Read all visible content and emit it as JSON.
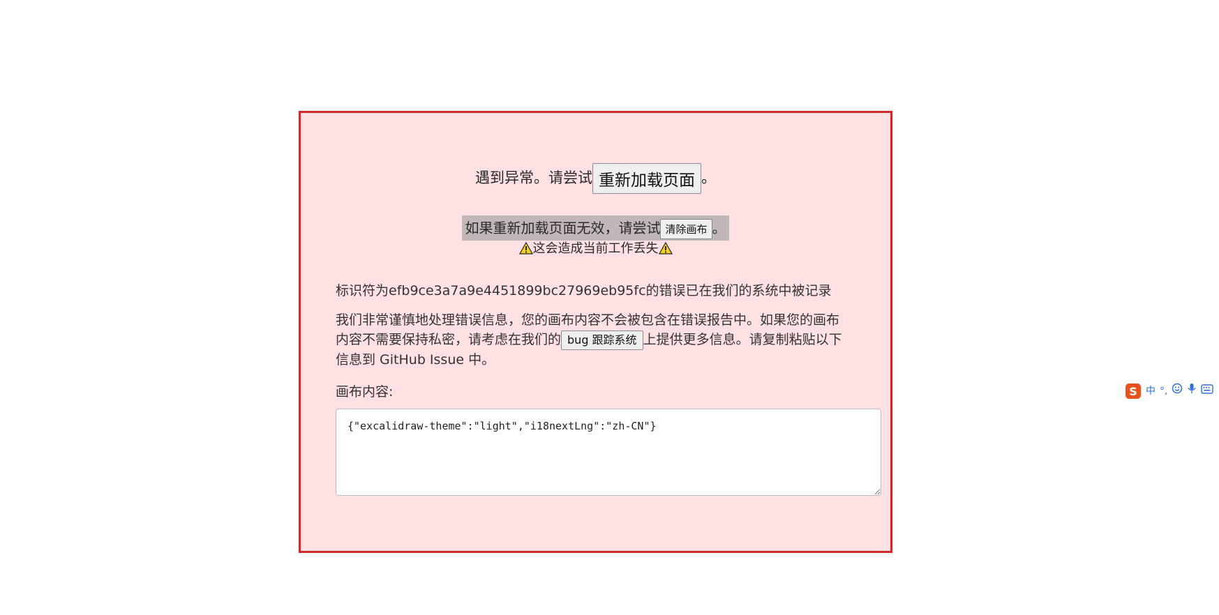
{
  "error": {
    "reload_prefix": "遇到异常。请尝试",
    "reload_button": "重新加载页面",
    "reload_suffix": "。",
    "clear_prefix": "如果重新加载页面无效，请尝试",
    "clear_button": "清除画布",
    "clear_suffix": "。",
    "warning_text": "这会造成当前工作丢失",
    "tracked_message": "标识符为efb9ce3a7a9e4451899bc27969eb95fc的错误已在我们的系统中被记录",
    "privacy_prefix": "我们非常谨慎地处理错误信息，您的画布内容不会被包含在错误报告中。如果您的画布内容不需要保持私密，请考虑在我们的",
    "bug_button": "bug 跟踪系统",
    "privacy_suffix": "上提供更多信息。请复制粘贴以下信息到 GitHub Issue 中。",
    "canvas_label": "画布内容:",
    "canvas_content": "{\"excalidraw-theme\":\"light\",\"i18nextLng\":\"zh-CN\"}"
  },
  "ime_toolbar": {
    "mode": "中",
    "punct": "°,",
    "items": [
      "sogou-logo-icon",
      "emoji-icon",
      "microphone-icon",
      "keyboard-icon"
    ]
  },
  "colors": {
    "border": "#d22a2a",
    "background": "#ffe0e3",
    "ime_accent": "#2e6fd8",
    "ime_logo": "#e8501c"
  }
}
